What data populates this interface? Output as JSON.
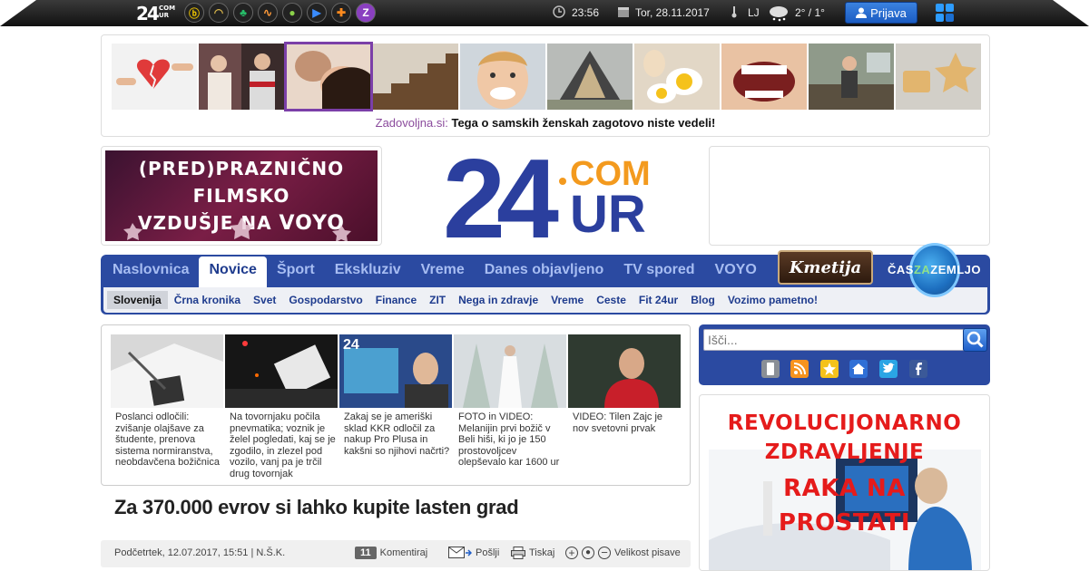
{
  "topbar": {
    "logo_main": "24",
    "logo_sub_top": "COM",
    "logo_sub_bottom": "UR",
    "time": "23:56",
    "date": "Tor, 28.11.2017",
    "location": "LJ",
    "temperature": "2° / 1°",
    "login_label": "Prijava",
    "partner_icons": [
      "bike-icon",
      "ball-icon",
      "tree-icon",
      "lines-icon",
      "apple-icon",
      "play-icon",
      "plus-icon",
      "z-icon"
    ]
  },
  "promo": {
    "source": "Zadovoljna.si:",
    "headline": "Tega o samskih ženskah zagotovo niste vedeli!",
    "thumbnails": [
      "broken-heart",
      "couple-photo",
      "kiss-photo",
      "stairs-photo",
      "boy-face",
      "a-frame-house",
      "eggs-photo",
      "open-mouth",
      "kitchen-woman",
      "star-cookies"
    ]
  },
  "banner": {
    "line1": "(PRED)PRAZNIČNO FILMSKO",
    "line2": "VZDUŠJE NA",
    "brand": "VOYO"
  },
  "logo": {
    "main": "24",
    "dot_com": "COM",
    "ur": "UR"
  },
  "nav": {
    "main": [
      "Naslovnica",
      "Novice",
      "Šport",
      "Ekskluziv",
      "Vreme",
      "Danes objavljeno",
      "TV spored",
      "VOYO"
    ],
    "active": "Novice",
    "sub": [
      "Slovenija",
      "Črna kronika",
      "Svet",
      "Gospodarstvo",
      "Finance",
      "ZIT",
      "Nega in zdravje",
      "Vreme",
      "Ceste",
      "Fit 24ur",
      "Blog",
      "Vozimo pametno!"
    ],
    "sub_active": "Slovenija",
    "kmetija": "Kmetija",
    "casza_1": "ČAS",
    "casza_2": "ZA",
    "casza_3": "ZEMLJO"
  },
  "news": [
    {
      "text": "Poslanci odločili: zvišanje olajšave za študente, prenova sistema normiranstva, neobdavčena božičnica"
    },
    {
      "text": "Na tovornjaku počila pnevmatika; voznik je želel pogledati, kaj se je zgodilo, in zlezel pod vozilo, vanj pa je trčil drug tovornjak"
    },
    {
      "text": "Zakaj se je ameriški sklad KKR odločil za nakup Pro Plusa in kakšni so njihovi načrti?"
    },
    {
      "text": "FOTO in VIDEO: Melanijin prvi božič v Beli hiši, ki jo je 150 prostovoljcev olepševalo kar 1600 ur"
    },
    {
      "text": "VIDEO: Tilen Zajc je nov svetovni prvak"
    }
  ],
  "article": {
    "headline": "Za 370.000 evrov si lahko kupite lasten grad",
    "byline": "Podčetrtek, 12.07.2017, 15:51 | N.Š.K.",
    "comments_count": "11",
    "comments_label": "Komentiraj",
    "send_label": "Pošlji",
    "print_label": "Tiskaj",
    "fontsize_label": "Velikost pisave"
  },
  "search": {
    "placeholder": "Išči..."
  },
  "social": [
    "mobile-icon",
    "rss-icon",
    "star-icon",
    "home-icon",
    "twitter-icon",
    "facebook-icon"
  ],
  "ad": {
    "line1": "REVOLUCIJONARNO",
    "line2": "ZDRAVLJENJE",
    "line3": "RAKA NA",
    "line4": "PROSTATI"
  },
  "colors": {
    "nav_blue": "#2b4aa1",
    "logo_blue": "#2b3f9e",
    "logo_orange": "#f39a1e",
    "promo_purple": "#7b3fa8"
  }
}
